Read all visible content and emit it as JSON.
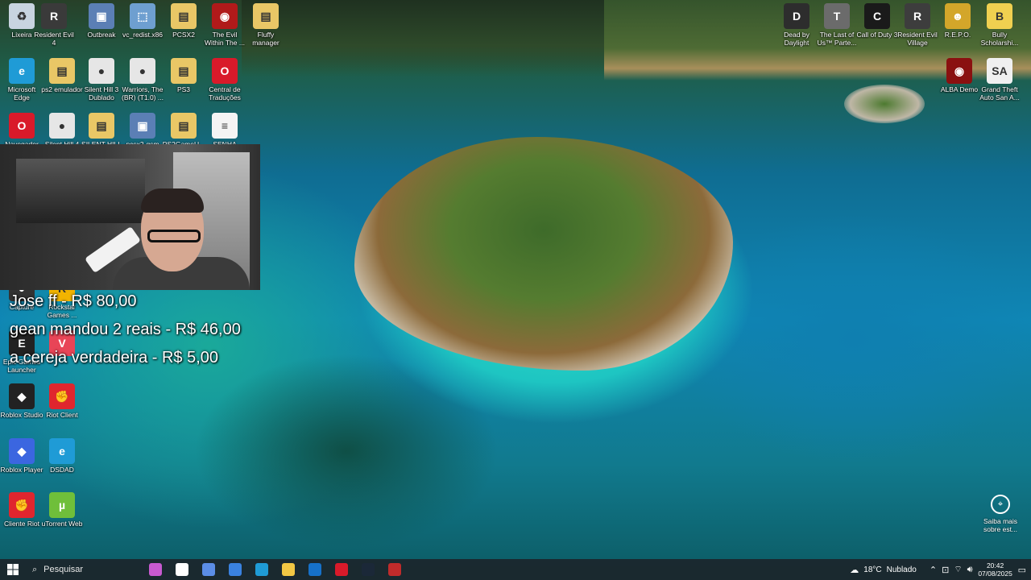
{
  "desktop_icons_left": [
    {
      "label": "Lixeira",
      "icon": "recycle-bin-icon",
      "color": "#c8d4e0",
      "glyph": "♻"
    },
    {
      "label": "Resident Evil 4",
      "icon": "game-icon",
      "color": "#3a3a3a",
      "glyph": "R"
    },
    {
      "label": "Outbreak",
      "icon": "computer-icon",
      "color": "#5b7fb5",
      "glyph": "▣"
    },
    {
      "label": "vc_redist.x86",
      "icon": "installer-icon",
      "color": "#6e9fd0",
      "glyph": "⬚"
    },
    {
      "label": "PCSX2",
      "icon": "folder-icon",
      "color": "#e9c766",
      "glyph": "▤"
    },
    {
      "label": "The Evil Within The ...",
      "icon": "game-icon",
      "color": "#b01a1a",
      "glyph": "◉"
    },
    {
      "label": "Fluffy manager",
      "icon": "folder-icon",
      "color": "#e9c766",
      "glyph": "▤"
    },
    {
      "label": "Microsoft Edge",
      "icon": "edge-icon",
      "color": "#1f9bd6",
      "glyph": "e"
    },
    {
      "label": "ps2 emulador",
      "icon": "file-icon",
      "color": "#e9c766",
      "glyph": "▤"
    },
    {
      "label": "Silent Hill 3 Dublado",
      "icon": "file-icon",
      "color": "#e6e6e6",
      "glyph": "●"
    },
    {
      "label": "Warriors, The (BR) (T1.0) ...",
      "icon": "file-icon",
      "color": "#e6e6e6",
      "glyph": "●"
    },
    {
      "label": "PS3",
      "icon": "folder-icon",
      "color": "#e9c766",
      "glyph": "▤"
    },
    {
      "label": "Central de Traduções",
      "icon": "opera-icon",
      "color": "#d91a2a",
      "glyph": "O"
    },
    {
      "label": "Navegador",
      "icon": "opera-icon",
      "color": "#d91a2a",
      "glyph": "O"
    },
    {
      "label": "Silent Hill 4",
      "icon": "file-icon",
      "color": "#e6e6e6",
      "glyph": "●"
    },
    {
      "label": "SILENT HILL",
      "icon": "folder-icon",
      "color": "#e9c766",
      "glyph": "▤"
    },
    {
      "label": "pcsx2-qsm",
      "icon": "file-icon",
      "color": "#5b7fb5",
      "glyph": "▣"
    },
    {
      "label": "PS2GameU...",
      "icon": "folder-icon",
      "color": "#e9c766",
      "glyph": "▤"
    },
    {
      "label": "SENHA",
      "icon": "text-file-icon",
      "color": "#f4f4f4",
      "glyph": "≡"
    },
    {
      "label": "Capture",
      "icon": "capture-icon",
      "color": "#333333",
      "glyph": "●"
    },
    {
      "label": "Rockstar Games ...",
      "icon": "rockstar-icon",
      "color": "#f2b400",
      "glyph": "R"
    },
    {
      "label": "Epic Games Launcher",
      "icon": "epic-icon",
      "color": "#222222",
      "glyph": "E"
    },
    {
      "label": "",
      "icon": "valorant-icon",
      "color": "#e84557",
      "glyph": "V"
    },
    {
      "label": "Roblox Studio",
      "icon": "roblox-studio-icon",
      "color": "#222222",
      "glyph": "◆"
    },
    {
      "label": "Riot Client",
      "icon": "riot-icon",
      "color": "#e0262e",
      "glyph": "✊"
    },
    {
      "label": "Roblox Player",
      "icon": "roblox-icon",
      "color": "#3b66e0",
      "glyph": "◆"
    },
    {
      "label": "DSDAD",
      "icon": "edge-icon",
      "color": "#1f9bd6",
      "glyph": "e"
    },
    {
      "label": "Cliente Riot",
      "icon": "riot-icon",
      "color": "#e0262e",
      "glyph": "✊"
    },
    {
      "label": "uTorrent Web",
      "icon": "utorrent-icon",
      "color": "#6fbf3a",
      "glyph": "µ"
    }
  ],
  "desktop_icons_right": [
    {
      "label": "Dead by Daylight",
      "icon": "game-icon",
      "color": "#2d2d2d",
      "glyph": "D"
    },
    {
      "label": "The Last of Us™ Parte...",
      "icon": "game-icon",
      "color": "#6b6b6b",
      "glyph": "T"
    },
    {
      "label": "Call of Duty 3",
      "icon": "game-icon",
      "color": "#1a1a1a",
      "glyph": "C"
    },
    {
      "label": "Resident Evil Village",
      "icon": "game-icon",
      "color": "#3d3d3d",
      "glyph": "R"
    },
    {
      "label": "R.E.P.O.",
      "icon": "game-icon",
      "color": "#d3a62a",
      "glyph": "☻"
    },
    {
      "label": "Bully Scholarshi...",
      "icon": "game-icon",
      "color": "#f0d050",
      "glyph": "B"
    },
    {
      "label": "ALBA Demo",
      "icon": "game-icon",
      "color": "#8a1010",
      "glyph": "◉"
    },
    {
      "label": "Grand Theft Auto San A...",
      "icon": "game-icon",
      "color": "#f0f0f0",
      "glyph": "SA"
    }
  ],
  "donations": [
    "Jose ff - R$ 80,00",
    "gean mandou 2 reais - R$ 46,00",
    "a cereja verdadeira - R$ 5,00"
  ],
  "saiba": {
    "label": "Saiba mais sobre est...",
    "icon": "camera-info-icon"
  },
  "taskbar": {
    "search_placeholder": "Pesquisar",
    "apps": [
      {
        "name": "widget-icon",
        "color": "#c85ad0"
      },
      {
        "name": "task-view-icon",
        "color": "#ffffff"
      },
      {
        "name": "copilot-icon",
        "color": "#5b8de6"
      },
      {
        "name": "store-icon",
        "color": "#3a82e0"
      },
      {
        "name": "edge-icon",
        "color": "#1f9bd6"
      },
      {
        "name": "file-explorer-icon",
        "color": "#f2c744"
      },
      {
        "name": "outlook-icon",
        "color": "#1671c9"
      },
      {
        "name": "opera-icon",
        "color": "#d91a2a"
      },
      {
        "name": "steam-icon",
        "color": "#1b2838"
      },
      {
        "name": "streaming-app-icon",
        "color": "#c02b2b"
      }
    ],
    "weather_temp": "18°C",
    "weather_desc": "Nublado",
    "time": "20:42",
    "date": "07/08/2025"
  }
}
